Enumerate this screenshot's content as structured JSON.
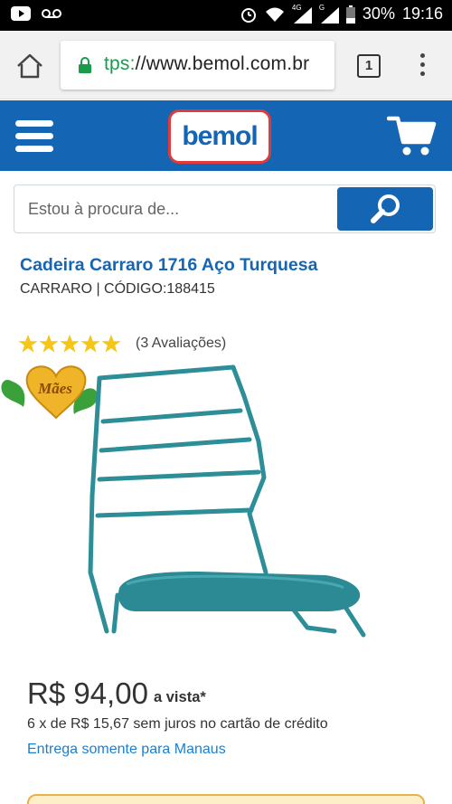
{
  "status_bar": {
    "battery": "30%",
    "time": "19:16",
    "icons": [
      "youtube-icon",
      "voicemail-icon",
      "alarm-icon",
      "wifi-icon",
      "signal-4g-icon",
      "signal-g-icon",
      "battery-icon"
    ],
    "network_labels": [
      "4G",
      "G"
    ]
  },
  "browser": {
    "url_scheme": "tps:",
    "url_rest": "//www.bemol.com.br",
    "tab_count": "1",
    "icons": [
      "home-icon",
      "lock-icon",
      "tabs-icon",
      "overflow-menu-icon"
    ]
  },
  "header": {
    "logo_text": "bemol",
    "icons": [
      "hamburger-menu-icon",
      "cart-icon"
    ],
    "colors": {
      "brand_blue": "#1565b5",
      "logo_border": "#e23a3a"
    }
  },
  "search": {
    "placeholder": "Estou à procura de...",
    "icon": "search-icon"
  },
  "product": {
    "title": "Cadeira Carraro 1716 Aço Turquesa",
    "meta": "CARRARO | CÓDIGO:188415",
    "rating_stars": 5,
    "reviews_text": "(3 Avaliações)",
    "badge_text": "Mães",
    "price": "R$ 94,00",
    "price_suffix": "a vista*",
    "installments": "6 x de R$ 15,67 sem juros no cartão de crédito",
    "delivery_note": "Entrega somente para Manaus",
    "colors": {
      "star": "#f5c518",
      "link": "#1a7fd1",
      "chair": "#2d8e98"
    }
  }
}
